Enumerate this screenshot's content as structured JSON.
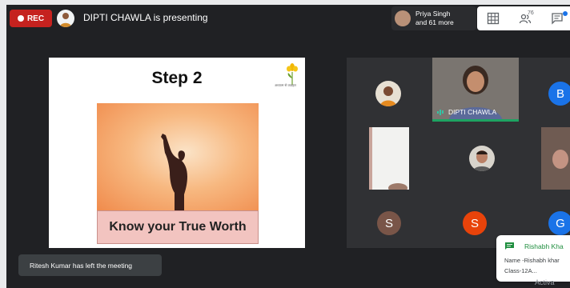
{
  "top_bar": {
    "rec_label": "REC",
    "presenting_text": "DIPTI CHAWLA is presenting",
    "participants_chip": {
      "line1": "Priya Singh",
      "line2": "and 61 more"
    },
    "people_count": "76"
  },
  "slide": {
    "title": "Step 2",
    "logo_text": "अध्यात्म से व्यवहार",
    "caption": "Know your True Worth"
  },
  "grid": {
    "main_speaker_name": "DIPTI CHAWLA",
    "tiles": [
      {
        "initial": "B",
        "color": "#1a73e8"
      },
      {
        "initial": "S",
        "color": "#795548"
      },
      {
        "initial": "S",
        "color": "#e8430a"
      },
      {
        "initial": "G",
        "color": "#1a73e8"
      }
    ]
  },
  "notifications": {
    "left_meeting": "Ritesh Kumar has left the meeting",
    "chat_sender": "Rishabh Kha",
    "chat_line1": "Name -Rishabh khar",
    "chat_line2": "Class-12A..."
  },
  "watermark": "Activa"
}
